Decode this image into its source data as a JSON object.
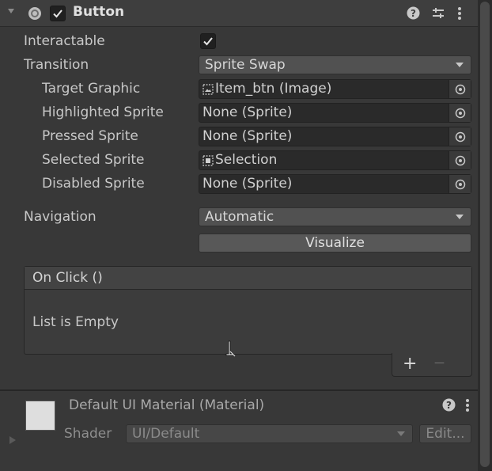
{
  "component": {
    "title": "Button",
    "enabled": true
  },
  "fields": {
    "interactable": {
      "label": "Interactable",
      "checked": true
    },
    "transition": {
      "label": "Transition",
      "value": "Sprite Swap"
    },
    "target_graphic": {
      "label": "Target Graphic",
      "value": "Item_btn (Image)",
      "icon": "image-icon"
    },
    "highlighted_sprite": {
      "label": "Highlighted Sprite",
      "value": "None (Sprite)"
    },
    "pressed_sprite": {
      "label": "Pressed Sprite",
      "value": "None (Sprite)"
    },
    "selected_sprite": {
      "label": "Selected Sprite",
      "value": "Selection",
      "icon": "sprite-icon"
    },
    "disabled_sprite": {
      "label": "Disabled Sprite",
      "value": "None (Sprite)"
    },
    "navigation": {
      "label": "Navigation",
      "value": "Automatic"
    },
    "visualize_label": "Visualize"
  },
  "on_click": {
    "title": "On Click ()",
    "empty_text": "List is Empty",
    "add_label": "+",
    "remove_label": "—"
  },
  "material": {
    "name": "Default UI Material (Material)",
    "shader_label": "Shader",
    "shader_value": "UI/Default",
    "edit_label": "Edit..."
  },
  "colors": {
    "background": "#383838",
    "field_bg": "#2a2a2a",
    "dropdown_bg": "#515151",
    "text": "#c4c4c4"
  }
}
